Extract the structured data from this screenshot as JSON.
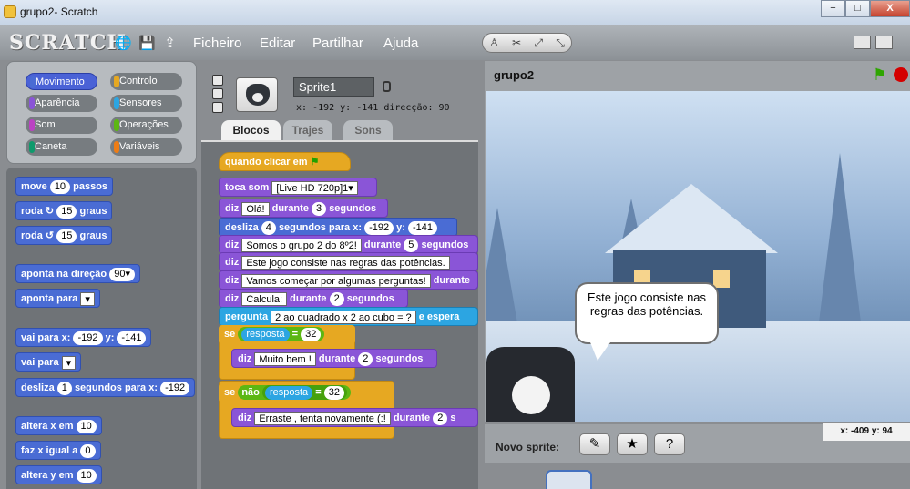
{
  "window": {
    "title": "grupo2- Scratch",
    "min": "−",
    "max": "□",
    "close": "X"
  },
  "app": {
    "logo": "SCRATCH",
    "globe_icon": "globe-icon",
    "save_icon": "save-icon",
    "share_icon": "share-icon"
  },
  "menus": [
    "Ficheiro",
    "Editar",
    "Partilhar",
    "Ajuda"
  ],
  "tools": {
    "stamp": "♙",
    "scissors": "✂",
    "grow": "⤢",
    "shrink": "⤡"
  },
  "categories": [
    {
      "label": "Movimento",
      "color": "#4a6cd4",
      "selected": true
    },
    {
      "label": "Controlo",
      "color": "#e6a822",
      "selected": false
    },
    {
      "label": "Aparência",
      "color": "#8a55d7",
      "selected": false
    },
    {
      "label": "Sensores",
      "color": "#2ca5e2",
      "selected": false
    },
    {
      "label": "Som",
      "color": "#bb42c3",
      "selected": false
    },
    {
      "label": "Operações",
      "color": "#5cb712",
      "selected": false
    },
    {
      "label": "Caneta",
      "color": "#0e9a6c",
      "selected": false
    },
    {
      "label": "Variáveis",
      "color": "#ee7d16",
      "selected": false
    }
  ],
  "palette": {
    "move": {
      "a": "move",
      "n": "10",
      "b": "passos"
    },
    "turn_cw": {
      "a": "roda",
      "icon": "↻",
      "n": "15",
      "b": "graus"
    },
    "turn_ccw": {
      "a": "roda",
      "icon": "↺",
      "n": "15",
      "b": "graus"
    },
    "point_dir": {
      "a": "aponta na direção",
      "n": "90▾"
    },
    "point_to": {
      "a": "aponta para",
      "n": "▾"
    },
    "goto_xy": {
      "a": "vai para x:",
      "x": "-192",
      "b": "y:",
      "y": "-141"
    },
    "goto": {
      "a": "vai para",
      "n": "▾"
    },
    "glide": {
      "a": "desliza",
      "n": "1",
      "b": "segundos para x:",
      "x": "-192"
    },
    "change_x": {
      "a": "altera x em",
      "n": "10"
    },
    "set_x": {
      "a": "faz x igual a",
      "n": "0"
    },
    "change_y": {
      "a": "altera y em",
      "n": "10"
    }
  },
  "sprite": {
    "name": "Sprite1",
    "coords": "x: -192  y: -141  direcção: 90",
    "tabs": [
      "Blocos",
      "Trajes",
      "Sons"
    ]
  },
  "script": {
    "hat": "quando clicar em",
    "sound": {
      "a": "toca som",
      "v": "[Live HD 720p]1▾"
    },
    "say1": {
      "a": "diz",
      "t": "Olá!",
      "b": "durante",
      "n": "3",
      "c": "segundos"
    },
    "glide": {
      "a": "desliza",
      "n": "4",
      "b": "segundos para x:",
      "x": "-192",
      "c": "y:",
      "y": "-141"
    },
    "say2": {
      "a": "diz",
      "t": "Somos o grupo 2  do 8º2!",
      "b": "durante",
      "n": "5",
      "c": "segundos"
    },
    "say3": {
      "a": "diz",
      "t": "Este jogo consiste nas regras das potências."
    },
    "say4": {
      "a": "diz",
      "t": "Vamos começar por algumas perguntas!",
      "b": "durante"
    },
    "say5": {
      "a": "diz",
      "t": "Calcula:",
      "b": "durante",
      "n": "2",
      "c": "segundos"
    },
    "ask": {
      "a": "pergunta",
      "t": "2 ao quadrado x 2 ao cubo = ?",
      "b": "e espera"
    },
    "if1": {
      "a": "se",
      "var": "resposta",
      "eq": "=",
      "n": "32"
    },
    "say6": {
      "a": "diz",
      "t": "Muito bem !",
      "b": "durante",
      "n": "2",
      "c": "segundos"
    },
    "if2": {
      "a": "se",
      "not": "não",
      "var": "resposta",
      "eq": "=",
      "n": "32"
    },
    "say7": {
      "a": "diz",
      "t": "Erraste , tenta novamente (:!",
      "b": "durante",
      "n": "2",
      "c": "s"
    }
  },
  "stage": {
    "title": "grupo2",
    "bubble": "Este jogo consiste nas regras das potências.",
    "mouse_coords": "x: -409   y: 94",
    "new_sprite_label": "Novo sprite:"
  }
}
